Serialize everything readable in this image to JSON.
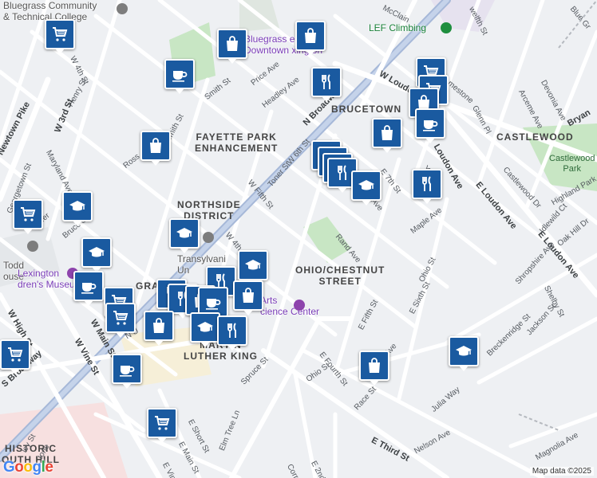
{
  "map": {
    "attribution": "Map data ©2025",
    "logo": [
      "G",
      "o",
      "o",
      "g",
      "l",
      "e"
    ],
    "logo_colors": [
      "#4285f4",
      "#ea4335",
      "#fbbc05",
      "#4285f4",
      "#34a853",
      "#ea4335"
    ]
  },
  "neighborhoods": {
    "fayette_park_1": "FAYETTE PARK",
    "fayette_park_2": "ENHANCEMENT",
    "northside_1": "NORTHSIDE",
    "northside_2": "DISTRICT",
    "brucetown": "BRUCETOWN",
    "castlewood": "CASTLEWOOD",
    "ohio_chestnut_1": "OHIO/CHESTNUT",
    "ohio_chestnut_2": "STREET",
    "mlk_1": "MARTIN",
    "mlk_2": "LUTHER KING",
    "gratz": "GRA",
    "historic_1": "HISTORIC",
    "historic_2": "OUTH HILL"
  },
  "pois": {
    "bluegrass_cc_1": "Bluegrass Community",
    "bluegrass_cc_2": "& Technical College",
    "bluegrass_outfitters_1": "Bluegrass   ers",
    "bluegrass_outfitters_2": "Downtown   xington",
    "lef_climbing": "LEF Climbing",
    "castlewood_park_1": "Castlewood",
    "castlewood_park_2": "Park",
    "todd_house_1": "Todd",
    "todd_house_2": "ouse",
    "childrens_museum_1": "Lexington",
    "childrens_museum_2": "dren's Museum",
    "transylvania_1": "Transylvani",
    "transylvania_2": "Un",
    "arts_center_1": "Arts",
    "arts_center_2": "cience Center"
  },
  "streets": {
    "w4th_top": "W 4th St",
    "henry": "Henry St",
    "w3rd": "W 3rd St",
    "newtown": "Newtown Pike",
    "maryland": "Maryland Ave",
    "georgetown": "Georgetown St",
    "jefferson": "Jeffer",
    "bruce": "Bruce St",
    "smith_top": "Smith St",
    "smith": "Smith St",
    "ross": "Ross",
    "price": "Price Ave",
    "headley": "Headley Ave",
    "nbroadway": "N Broadway",
    "mcclain": "McClain",
    "wloudon": "W Loudon",
    "w6th": "W 6th St",
    "toner": "Toner St",
    "wfifth": "W Fifth St",
    "w4th": "W 4th St",
    "e7th": "E 7th St",
    "lima": "Lima Ave",
    "york": "York St",
    "rand": "Rand Ave",
    "maple": "Maple Ave",
    "ohio_r": "Ohio St",
    "esixth": "E Sixth St",
    "efifth": "E Fifth St",
    "efourth": "E Fourth St",
    "ohio_b": "Ohio St",
    "race": "Race St",
    "juliaway": "Julia Way",
    "nelson": "Nelson Ave",
    "ethird": "E Third St",
    "magnolia": "Magnolia Ave",
    "eloudon": "E Loudon Ave",
    "eloudon2": "E Loudon Ave",
    "loudon_mid": "Loudon Ave",
    "glennpl": "Glenn Pl",
    "arceme": "Arceme Ave",
    "devonia": "Devonia Ave",
    "limestone": "mestone",
    "castlewood_dr": "Castlewood Dr",
    "highland": "Highland Park",
    "idlewild": "Idlewild Ct",
    "oakhill": "Oak Hill Dr",
    "shropshire": "Shropshire Ave",
    "shelby": "Shelby St",
    "jackson": "Jackson St",
    "breckenridge": "Breckenridge St",
    "spruce": "Spruce St",
    "elmtree": "Elm Tree Ln",
    "eshort": "E Short St",
    "emain": "E Main St",
    "evine": "E Vine St",
    "corral": "Corral St",
    "e2nd": "E 2nd St",
    "whigh": "W High St",
    "wmain": "W Main St",
    "wvine": "W Vine St",
    "sbroadway": "S Broadway",
    "twelfth": "welfth St",
    "bluegrass_ave": "Blue Gr",
    "bryan": "Bryan",
    "vine_r": "Ave",
    "nu": "N U",
    "ohio_mid": "Ohio St",
    "eave": "Ave",
    "vine_btm": "Ave",
    "ley": "ley St",
    "stone": "tone"
  },
  "markers": [
    {
      "name": "shopping-cart-marker",
      "icon": "cart"
    },
    {
      "name": "shopping-bag-marker",
      "icon": "bag"
    },
    {
      "name": "cafe-marker",
      "icon": "cup"
    },
    {
      "name": "restaurant-marker",
      "icon": "fork"
    },
    {
      "name": "school-marker",
      "icon": "cap"
    }
  ]
}
